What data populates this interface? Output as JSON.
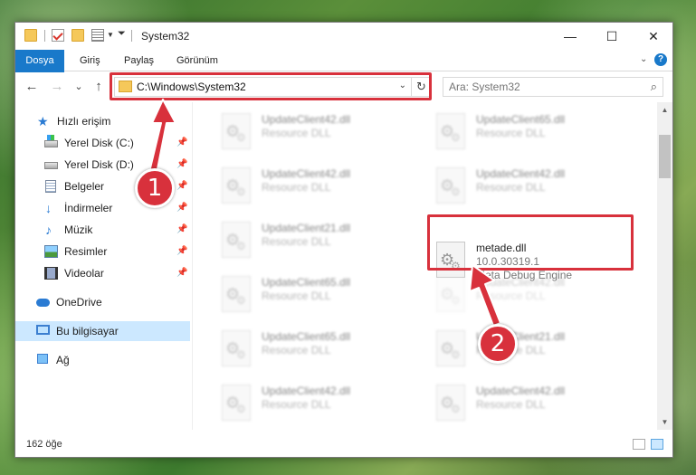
{
  "window": {
    "title": "System32",
    "controls": {
      "minimize": "—",
      "maximize": "☐",
      "close": "✕"
    }
  },
  "ribbon": {
    "tabs": [
      "Dosya",
      "Giriş",
      "Paylaş",
      "Görünüm"
    ],
    "expand_icon": "chevron-down-icon",
    "help": "?"
  },
  "nav": {
    "back": "←",
    "forward": "→",
    "recent": "⌄",
    "up": "↑",
    "address": "C:\\Windows\\System32",
    "refresh": "↻",
    "search_placeholder": "Ara: System32"
  },
  "sidebar": {
    "items": [
      {
        "label": "Hızlı erişim",
        "icon": "quick-access-star-icon",
        "pinned": false
      },
      {
        "label": "Yerel Disk (C:)",
        "icon": "local-disk-c-icon",
        "pinned": true
      },
      {
        "label": "Yerel Disk (D:)",
        "icon": "local-disk-d-icon",
        "pinned": true
      },
      {
        "label": "Belgeler",
        "icon": "documents-icon",
        "pinned": true
      },
      {
        "label": "İndirmeler",
        "icon": "downloads-icon",
        "pinned": true
      },
      {
        "label": "Müzik",
        "icon": "music-icon",
        "pinned": true
      },
      {
        "label": "Resimler",
        "icon": "pictures-icon",
        "pinned": true
      },
      {
        "label": "Videolar",
        "icon": "videos-icon",
        "pinned": true
      },
      {
        "label": "OneDrive",
        "icon": "onedrive-icon",
        "pinned": false
      },
      {
        "label": "Bu bilgisayar",
        "icon": "this-pc-icon",
        "pinned": false,
        "selected": true
      },
      {
        "label": "Ağ",
        "icon": "network-icon",
        "pinned": false
      }
    ]
  },
  "files": [
    {
      "name": "UpdateClient42.dll",
      "desc": "Resource DLL"
    },
    {
      "name": "UpdateClient65.dll",
      "desc": "Resource DLL"
    },
    {
      "name": "UpdateClient42.dll",
      "desc": "Resource DLL"
    },
    {
      "name": "UpdateClient42.dll",
      "desc": "Resource DLL"
    },
    {
      "name": "UpdateClient21.dll",
      "desc": "Resource DLL"
    },
    {
      "name": "metade.dll",
      "version": "10.0.30319.1",
      "desc": "Meta Debug Engine",
      "highlight": true
    },
    {
      "name": "UpdateClient65.dll",
      "desc": "Resource DLL"
    },
    {
      "name": "UpdateClient42.dll",
      "desc": "Resource DLL"
    },
    {
      "name": "UpdateClient65.dll",
      "desc": "Resource DLL"
    },
    {
      "name": "UpdateClient21.dll",
      "desc": "Resource DLL"
    },
    {
      "name": "UpdateClient42.dll",
      "desc": "Resource DLL"
    },
    {
      "name": "UpdateClient42.dll",
      "desc": "Resource DLL"
    }
  ],
  "status": {
    "count": "162 öğe"
  },
  "callouts": [
    "1",
    "2"
  ],
  "colors": {
    "accent": "#1979ca",
    "highlight": "#d8313c",
    "selected": "#cce8ff"
  }
}
